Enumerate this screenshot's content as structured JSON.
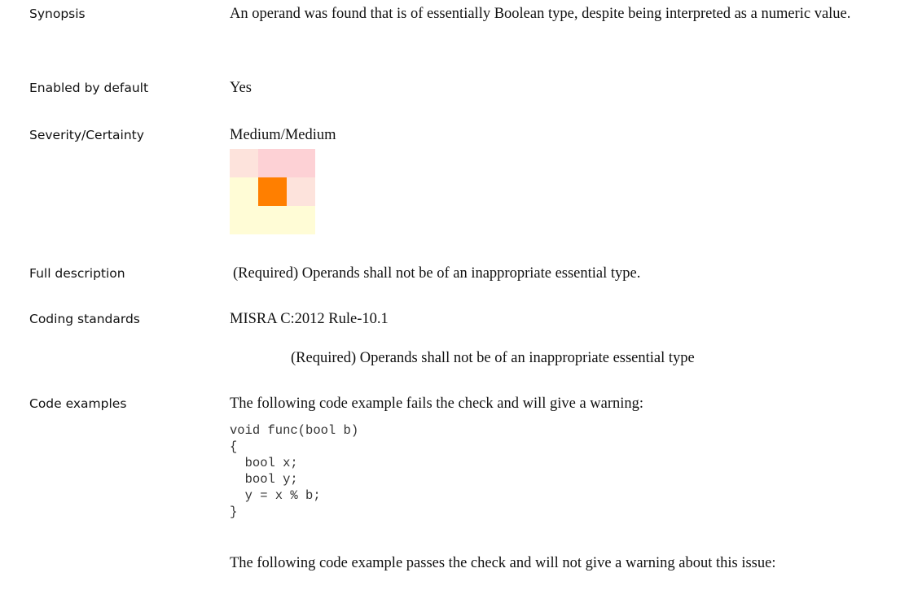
{
  "synopsis": {
    "label": "Synopsis",
    "text": "An operand was found that is of essentially Boolean type, despite being interpreted as a numeric value."
  },
  "enabled": {
    "label": "Enabled by default",
    "text": "Yes"
  },
  "severity": {
    "label": "Severity/Certainty",
    "text": "Medium/Medium",
    "grid_colors": [
      [
        "#fde3dc",
        "#fdd1d5",
        "#fdd1d5"
      ],
      [
        "#fffcd6",
        "#ff7f00",
        "#fde3dc"
      ],
      [
        "#fffcd6",
        "#fffcd6",
        "#fffcd6"
      ]
    ]
  },
  "full_description": {
    "label": "Full description",
    "text": "(Required) Operands shall not be of an inappropriate essential type."
  },
  "coding_standards": {
    "label": "Coding standards",
    "standard": "MISRA C:2012 Rule-10.1",
    "detail": "(Required) Operands shall not be of an inappropriate essential type"
  },
  "code_examples": {
    "label": "Code examples",
    "fail_intro": "The following code example fails the check and will give a warning:",
    "fail_code": "void func(bool b)\n{\n  bool x;\n  bool y;\n  y = x % b;\n}",
    "pass_intro": "The following code example passes the check and will not give a warning about this issue:"
  }
}
